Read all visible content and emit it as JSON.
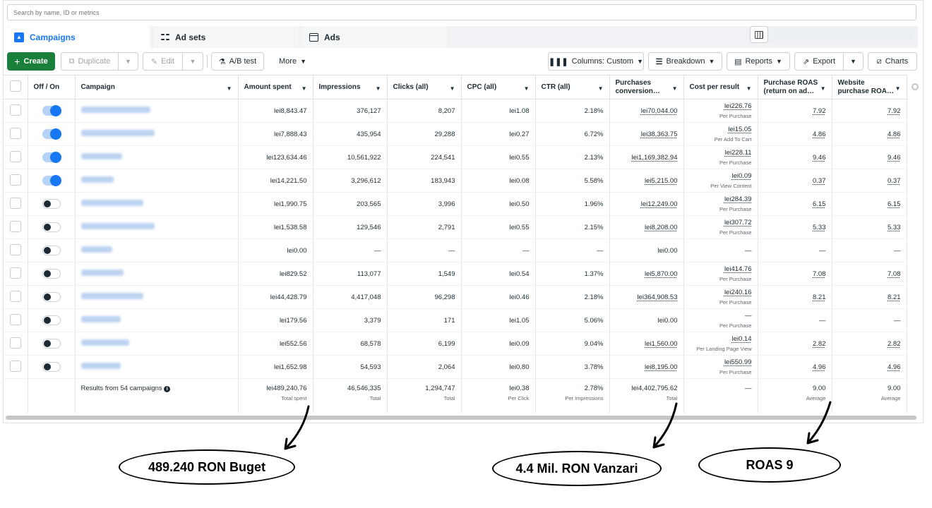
{
  "search": {
    "placeholder": "Search by name, ID or metrics"
  },
  "tabs": [
    {
      "label": "Campaigns"
    },
    {
      "label": "Ad sets"
    },
    {
      "label": "Ads"
    }
  ],
  "toolbar": {
    "create": "Create",
    "duplicate": "Duplicate",
    "edit": "Edit",
    "ab_test": "A/B test",
    "more": "More",
    "columns": "Columns: Custom",
    "breakdown": "Breakdown",
    "reports": "Reports",
    "export": "Export",
    "charts": "Charts"
  },
  "columns": {
    "onoff": "Off / On",
    "campaign": "Campaign",
    "spent": "Amount spent",
    "impressions": "Impressions",
    "clicks": "Clicks (all)",
    "cpc": "CPC (all)",
    "ctr": "CTR (all)",
    "purchases": "Purchases conversion…",
    "cpr": "Cost per result",
    "roas": "Purchase ROAS (return on ad…",
    "wroas": "Website purchase ROA…"
  },
  "rows": [
    {
      "on": true,
      "spent": "lei8,843.47",
      "impressions": "376,127",
      "clicks": "8,207",
      "cpc": "lei1.08",
      "ctr": "2.18%",
      "conv": "lei70,044.00",
      "cpr": "lei226.76",
      "cpr_sub": "Per Purchase",
      "roas": "7.92",
      "wroas": "7.92"
    },
    {
      "on": true,
      "spent": "lei7,888.43",
      "impressions": "435,954",
      "clicks": "29,288",
      "cpc": "lei0.27",
      "ctr": "6.72%",
      "conv": "lei38,363.75",
      "cpr": "lei15.05",
      "cpr_sub": "Per Add To Cart",
      "roas": "4.86",
      "wroas": "4.86"
    },
    {
      "on": true,
      "spent": "lei123,634.46",
      "impressions": "10,561,922",
      "clicks": "224,541",
      "cpc": "lei0.55",
      "ctr": "2.13%",
      "conv": "lei1,169,382.94",
      "cpr": "lei228.11",
      "cpr_sub": "Per Purchase",
      "roas": "9.46",
      "wroas": "9.46"
    },
    {
      "on": true,
      "spent": "lei14,221.50",
      "impressions": "3,296,612",
      "clicks": "183,943",
      "cpc": "lei0.08",
      "ctr": "5.58%",
      "conv": "lei5,215.00",
      "cpr": "lei0.09",
      "cpr_sub": "Per View Content",
      "roas": "0.37",
      "wroas": "0.37"
    },
    {
      "on": false,
      "spent": "lei1,990.75",
      "impressions": "203,565",
      "clicks": "3,996",
      "cpc": "lei0.50",
      "ctr": "1.96%",
      "conv": "lei12,249.00",
      "cpr": "lei284.39",
      "cpr_sub": "Per Purchase",
      "roas": "6.15",
      "wroas": "6.15"
    },
    {
      "on": false,
      "spent": "lei1,538.58",
      "impressions": "129,546",
      "clicks": "2,791",
      "cpc": "lei0.55",
      "ctr": "2.15%",
      "conv": "lei8,208.00",
      "cpr": "lei307.72",
      "cpr_sub": "Per Purchase",
      "roas": "5.33",
      "wroas": "5.33"
    },
    {
      "on": false,
      "spent": "lei0.00",
      "impressions": "—",
      "clicks": "—",
      "cpc": "—",
      "ctr": "—",
      "conv": "lei0.00",
      "cpr": "—",
      "cpr_sub": "",
      "roas": "—",
      "wroas": "—"
    },
    {
      "on": false,
      "spent": "lei829.52",
      "impressions": "113,077",
      "clicks": "1,549",
      "cpc": "lei0.54",
      "ctr": "1.37%",
      "conv": "lei5,870.00",
      "cpr": "lei414.76",
      "cpr_sub": "Per Purchase",
      "roas": "7.08",
      "wroas": "7.08"
    },
    {
      "on": false,
      "spent": "lei44,428.79",
      "impressions": "4,417,048",
      "clicks": "96,298",
      "cpc": "lei0.46",
      "ctr": "2.18%",
      "conv": "lei364,908.53",
      "cpr": "lei240.16",
      "cpr_sub": "Per Purchase",
      "roas": "8.21",
      "wroas": "8.21"
    },
    {
      "on": false,
      "spent": "lei179.56",
      "impressions": "3,379",
      "clicks": "171",
      "cpc": "lei1.05",
      "ctr": "5.06%",
      "conv": "lei0.00",
      "cpr": "—",
      "cpr_sub": "Per Purchase",
      "roas": "—",
      "wroas": "—"
    },
    {
      "on": false,
      "spent": "lei552.56",
      "impressions": "68,578",
      "clicks": "6,199",
      "cpc": "lei0.09",
      "ctr": "9.04%",
      "conv": "lei1,560.00",
      "cpr": "lei0.14",
      "cpr_sub": "Per Landing Page View",
      "roas": "2.82",
      "wroas": "2.82"
    },
    {
      "on": false,
      "spent": "lei1,652.98",
      "impressions": "54,593",
      "clicks": "2,064",
      "cpc": "lei0.80",
      "ctr": "3.78%",
      "conv": "lei8,195.00",
      "cpr": "lei550.99",
      "cpr_sub": "Per Purchase",
      "roas": "4.96",
      "wroas": "4.96"
    }
  ],
  "totals": {
    "label": "Results from 54 campaigns",
    "spent": "lei489,240.76",
    "spent_sub": "Total spent",
    "impressions": "46,546,335",
    "impressions_sub": "Total",
    "clicks": "1,294,747",
    "clicks_sub": "Total",
    "cpc": "lei0.38",
    "cpc_sub": "Per Click",
    "ctr": "2.78%",
    "ctr_sub": "Per Impressions",
    "conv": "lei4,402,795.62",
    "conv_sub": "Total",
    "cpr": "—",
    "roas": "9.00",
    "roas_sub": "Average",
    "wroas": "9.00",
    "wroas_sub": "Average"
  },
  "annotations": {
    "budget": "489.240 RON Buget",
    "sales": "4.4 Mil. RON Vanzari",
    "roas": "ROAS 9"
  }
}
